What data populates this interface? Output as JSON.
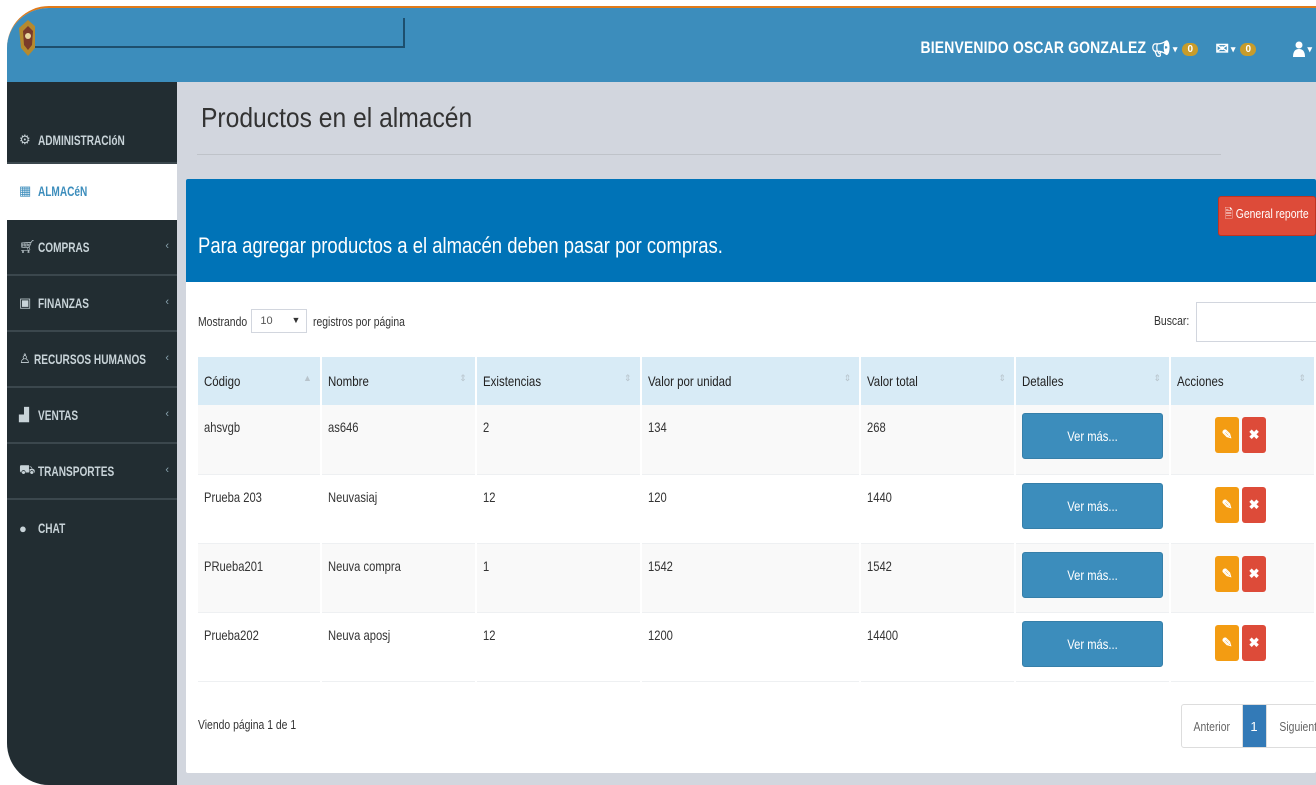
{
  "header": {
    "welcome": "BIENVENIDO OSCAR GONZALEZ",
    "notifications_count": "0",
    "messages_count": "0"
  },
  "sidebar": {
    "items": [
      {
        "label": "ADMINISTRACIóN",
        "icon": "dashboard-icon"
      },
      {
        "label": "ALMACéN",
        "icon": "archive-icon"
      },
      {
        "label": "COMPRAS",
        "icon": "cart-icon"
      },
      {
        "label": "FINANZAS",
        "icon": "money-icon"
      },
      {
        "label": "RECURSOS HUMANOS",
        "icon": "person-icon"
      },
      {
        "label": "VENTAS",
        "icon": "truck-icon"
      },
      {
        "label": "TRANSPORTES",
        "icon": "car-icon"
      },
      {
        "label": "CHAT",
        "icon": "chat-icon"
      }
    ]
  },
  "page": {
    "title": "Productos en el almacén"
  },
  "box": {
    "title": "Para agregar productos a el almacén deben pasar por compras.",
    "report_button": "General reporte"
  },
  "table_controls": {
    "showing_prefix": "Mostrando",
    "page_length": "10",
    "showing_suffix": "registros por página",
    "search_label": "Buscar:",
    "search_value": ""
  },
  "table": {
    "headers": [
      "Código",
      "Nombre",
      "Existencias",
      "Valor por unidad",
      "Valor total",
      "Detalles",
      "Acciones"
    ],
    "details_button": "Ver más...",
    "rows": [
      {
        "codigo": "ahsvgb",
        "nombre": "as646",
        "existencias": "2",
        "valor_unidad": "134",
        "valor_total": "268"
      },
      {
        "codigo": "Prueba 203",
        "nombre": "Neuvasiaj",
        "existencias": "12",
        "valor_unidad": "120",
        "valor_total": "1440"
      },
      {
        "codigo": "PRueba201",
        "nombre": "Neuva compra",
        "existencias": "1",
        "valor_unidad": "1542",
        "valor_total": "1542"
      },
      {
        "codigo": "Prueba202",
        "nombre": "Neuva aposj",
        "existencias": "12",
        "valor_unidad": "1200",
        "valor_total": "14400"
      }
    ]
  },
  "footer": {
    "page_info": "Viendo página 1 de 1",
    "prev": "Anterior",
    "current": "1",
    "next": "Siguiente"
  },
  "colors": {
    "topbar": "#3c8dbc",
    "sidebar": "#222d32",
    "box_header": "#0073b7",
    "danger": "#dd4b39",
    "warning": "#f39c12"
  }
}
